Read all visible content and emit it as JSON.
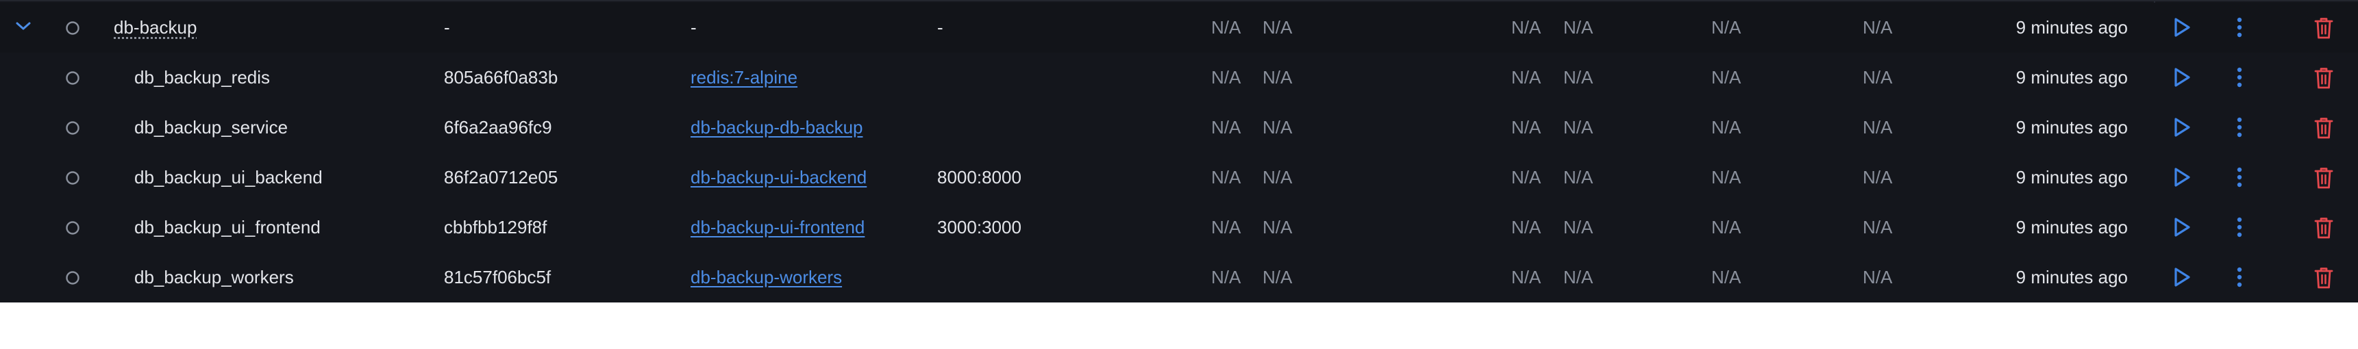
{
  "colors": {
    "background": "#14161c",
    "text": "#e3e5ea",
    "muted": "#8a909c",
    "link": "#4c8de6",
    "action": "#3f84e6",
    "danger": "#e5484d"
  },
  "group": {
    "name": "db-backup",
    "container_id": "-",
    "image": "-",
    "ports": "-",
    "cpu": "N/A",
    "cpu_limit": "N/A",
    "memory": "N/A",
    "memory_limit": "N/A",
    "disk": "N/A",
    "network": "N/A",
    "started": "9 minutes ago",
    "expanded": true
  },
  "containers": [
    {
      "name": "db_backup_redis",
      "container_id": "805a66f0a83b",
      "image": "redis:7-alpine",
      "ports": "",
      "cpu": "N/A",
      "cpu_limit": "N/A",
      "memory": "N/A",
      "memory_limit": "N/A",
      "disk": "N/A",
      "network": "N/A",
      "started": "9 minutes ago"
    },
    {
      "name": "db_backup_service",
      "container_id": "6f6a2aa96fc9",
      "image": "db-backup-db-backup",
      "ports": "",
      "cpu": "N/A",
      "cpu_limit": "N/A",
      "memory": "N/A",
      "memory_limit": "N/A",
      "disk": "N/A",
      "network": "N/A",
      "started": "9 minutes ago"
    },
    {
      "name": "db_backup_ui_backend",
      "container_id": "86f2a0712e05",
      "image": "db-backup-ui-backend",
      "ports": "8000:8000",
      "cpu": "N/A",
      "cpu_limit": "N/A",
      "memory": "N/A",
      "memory_limit": "N/A",
      "disk": "N/A",
      "network": "N/A",
      "started": "9 minutes ago"
    },
    {
      "name": "db_backup_ui_frontend",
      "container_id": "cbbfbb129f8f",
      "image": "db-backup-ui-frontend",
      "ports": "3000:3000",
      "cpu": "N/A",
      "cpu_limit": "N/A",
      "memory": "N/A",
      "memory_limit": "N/A",
      "disk": "N/A",
      "network": "N/A",
      "started": "9 minutes ago"
    },
    {
      "name": "db_backup_workers",
      "container_id": "81c57f06bc5f",
      "image": "db-backup-workers",
      "ports": "",
      "cpu": "N/A",
      "cpu_limit": "N/A",
      "memory": "N/A",
      "memory_limit": "N/A",
      "disk": "N/A",
      "network": "N/A",
      "started": "9 minutes ago"
    }
  ],
  "icons": {
    "expand": "chevron-down-icon",
    "status": "status-circle-icon",
    "start": "play-icon",
    "more": "kebab-menu-icon",
    "delete": "trash-icon"
  }
}
